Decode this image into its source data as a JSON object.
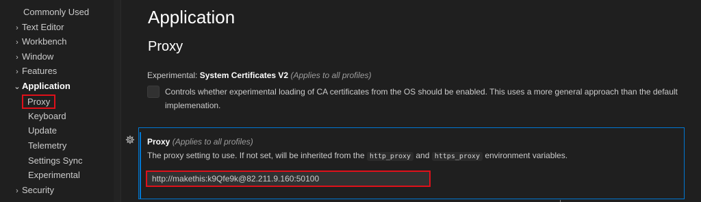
{
  "sidebar": {
    "items": [
      {
        "label": "Commonly Used",
        "chevron": "",
        "state": "normal"
      },
      {
        "label": "Text Editor",
        "chevron": "›",
        "state": "normal"
      },
      {
        "label": "Workbench",
        "chevron": "›",
        "state": "normal"
      },
      {
        "label": "Window",
        "chevron": "›",
        "state": "normal"
      },
      {
        "label": "Features",
        "chevron": "›",
        "state": "normal"
      },
      {
        "label": "Application",
        "chevron": "⌄",
        "state": "active"
      },
      {
        "label": "Proxy",
        "chevron": "",
        "state": "highlight"
      },
      {
        "label": "Keyboard",
        "chevron": "",
        "state": "normal"
      },
      {
        "label": "Update",
        "chevron": "",
        "state": "normal"
      },
      {
        "label": "Telemetry",
        "chevron": "",
        "state": "normal"
      },
      {
        "label": "Settings Sync",
        "chevron": "",
        "state": "normal"
      },
      {
        "label": "Experimental",
        "chevron": "",
        "state": "normal"
      },
      {
        "label": "Security",
        "chevron": "›",
        "state": "normal"
      }
    ]
  },
  "main": {
    "section_title": "Application",
    "subsection_title": "Proxy",
    "system_certificates": {
      "prefix": "Experimental: ",
      "name": "System Certificates V2",
      "scope": "(Applies to all profiles)",
      "description": "Controls whether experimental loading of CA certificates from the OS should be enabled. This uses a more general approach than the default implemenation.",
      "checked": false
    },
    "proxy_setting": {
      "name": "Proxy",
      "scope": "(Applies to all profiles)",
      "desc_before": "The proxy setting to use. If not set, will be inherited from the ",
      "code1": "http_proxy",
      "desc_middle": " and ",
      "code2": "https_proxy",
      "desc_after": " environment variables.",
      "value": "http://makethis:k9Qfe9k@82.211.9.160:50100"
    }
  },
  "colors": {
    "background": "#1f1f1f",
    "focus_border": "#0078d4",
    "highlight_red": "#e0101a"
  }
}
